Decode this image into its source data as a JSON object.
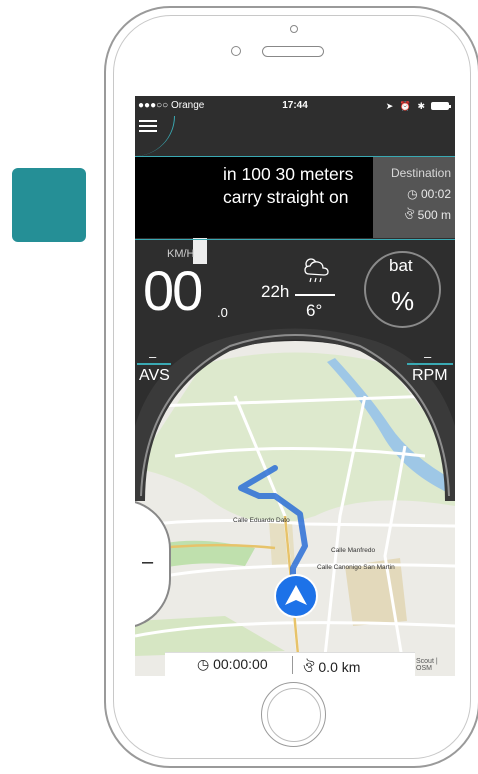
{
  "status_bar": {
    "carrier": "●●●○○ Orange",
    "time": "17:44"
  },
  "navigation": {
    "instruction": "in 100 30 meters carry straight on",
    "destination_title": "Destination",
    "destination_time": "00:02",
    "destination_distance": "500 m"
  },
  "dashboard": {
    "speed_unit": "KM/H",
    "speed": "00",
    "speed_decimal": ".0",
    "time_hours": "22h",
    "temperature": "6°",
    "battery_label": "bat",
    "battery_value": "%",
    "avs_value": "–",
    "avs_label": "AVS",
    "rpm_value": "–",
    "rpm_label": "RPM"
  },
  "map": {
    "streets": [
      "Calle Eduardo Dato",
      "Calle Manfredo",
      "Calle Canonigo San Martin"
    ],
    "zoom_out_label": "–",
    "attribution": "Scout | OSM"
  },
  "trip": {
    "elapsed": "00:00:00",
    "distance": "0.0 km"
  },
  "colors": {
    "accent": "#3aa9b3",
    "side_button": "#258f96",
    "route": "#2b6fd6",
    "location": "#1d72e8"
  }
}
